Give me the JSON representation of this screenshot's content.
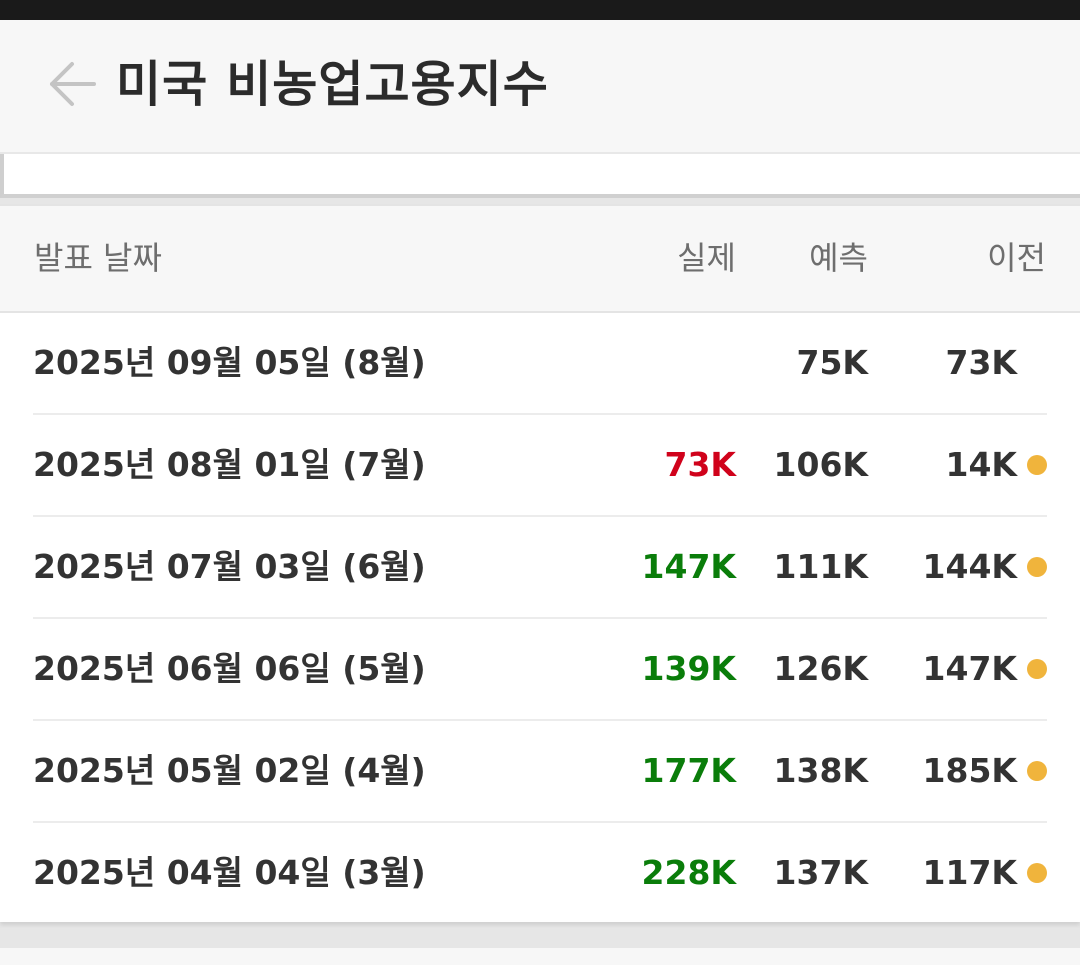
{
  "header": {
    "title": "미국 비농업고용지수"
  },
  "colors": {
    "negative": "#d0021b",
    "positive": "#0a7d0a",
    "revision_dot": "#f0b43c",
    "neutral": "#333333"
  },
  "table": {
    "columns": {
      "date": "발표 날짜",
      "actual": "실제",
      "forecast": "예측",
      "previous": "이전"
    },
    "rows": [
      {
        "date": "2025년 09월 05일 (8월)",
        "actual": "",
        "actual_trend": "none",
        "forecast": "75K",
        "previous": "73K",
        "previous_revised": false
      },
      {
        "date": "2025년 08월 01일 (7월)",
        "actual": "73K",
        "actual_trend": "negative",
        "forecast": "106K",
        "previous": "14K",
        "previous_revised": true
      },
      {
        "date": "2025년 07월 03일 (6월)",
        "actual": "147K",
        "actual_trend": "positive",
        "forecast": "111K",
        "previous": "144K",
        "previous_revised": true
      },
      {
        "date": "2025년 06월 06일 (5월)",
        "actual": "139K",
        "actual_trend": "positive",
        "forecast": "126K",
        "previous": "147K",
        "previous_revised": true
      },
      {
        "date": "2025년 05월 02일 (4월)",
        "actual": "177K",
        "actual_trend": "positive",
        "forecast": "138K",
        "previous": "185K",
        "previous_revised": true
      },
      {
        "date": "2025년 04월 04일 (3월)",
        "actual": "228K",
        "actual_trend": "positive",
        "forecast": "137K",
        "previous": "117K",
        "previous_revised": true
      }
    ]
  }
}
